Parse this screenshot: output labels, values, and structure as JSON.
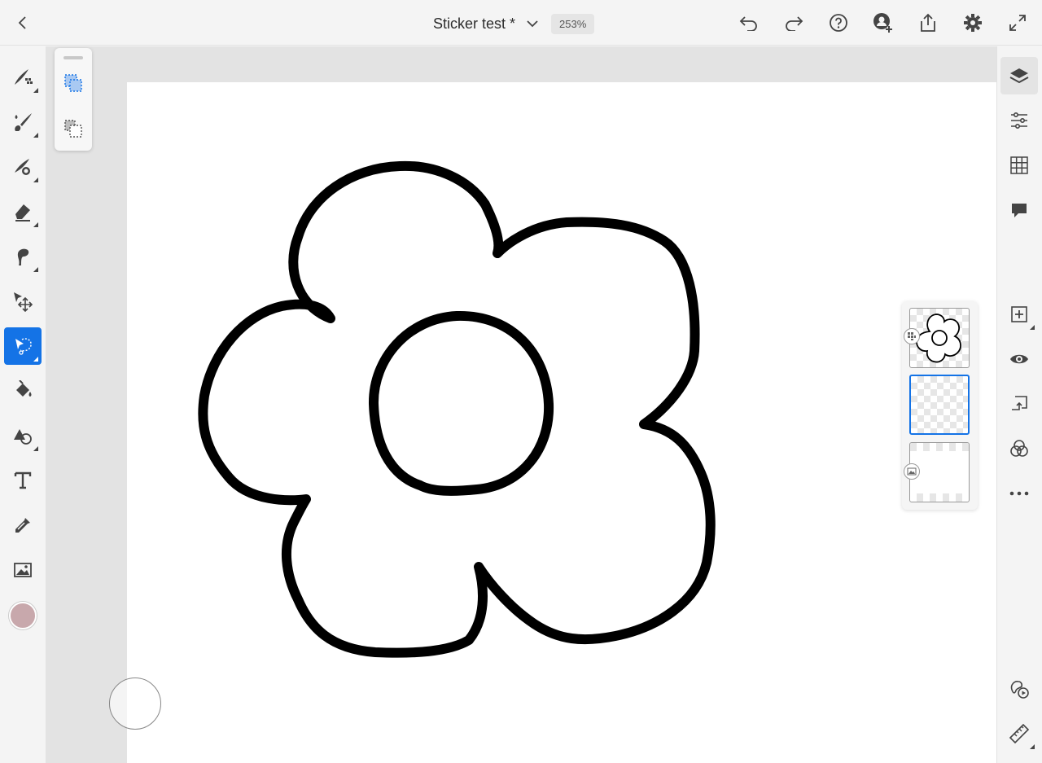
{
  "app": {
    "document_title": "Sticker test *",
    "zoom_level": "253%"
  },
  "top_bar": {
    "icons": [
      "back-icon",
      "title-dropdown-icon",
      "undo-icon",
      "redo-icon",
      "help-icon",
      "invite-icon",
      "share-icon",
      "settings-icon",
      "fullscreen-icon"
    ]
  },
  "left_tools": [
    {
      "name": "pixel-brush-tool",
      "active": false
    },
    {
      "name": "live-brush-tool",
      "active": false
    },
    {
      "name": "mixer-brush-tool",
      "active": false
    },
    {
      "name": "eraser-tool",
      "active": false
    },
    {
      "name": "smudge-tool",
      "active": false
    },
    {
      "name": "transform-tool",
      "active": false
    },
    {
      "name": "selection-tool",
      "active": true
    },
    {
      "name": "fill-tool",
      "active": false
    },
    {
      "name": "shapes-tool",
      "active": false
    },
    {
      "name": "text-tool",
      "active": false,
      "glyph": "T"
    },
    {
      "name": "eyedropper-tool",
      "active": false
    },
    {
      "name": "place-image-tool",
      "active": false
    }
  ],
  "current_color": "#c8a8ac",
  "selection_subtools": [
    "add-selection-icon",
    "subtract-selection-icon"
  ],
  "layers": [
    {
      "name": "flower-outline-layer",
      "type": "drawing",
      "selected": false
    },
    {
      "name": "empty-layer",
      "type": "drawing",
      "selected": true
    },
    {
      "name": "background-layer",
      "type": "image",
      "selected": false
    }
  ],
  "right_tools": [
    "layers-icon",
    "layer-properties-icon",
    "grid-icon",
    "comments-icon",
    "add-layer-icon",
    "visibility-icon",
    "merge-down-icon",
    "blend-mode-icon",
    "more-icon",
    "timelapse-icon",
    "ruler-icon"
  ],
  "colors": {
    "accent": "#1473e6",
    "stroke": "#000000",
    "toolbar_bg": "#f4f4f4"
  }
}
